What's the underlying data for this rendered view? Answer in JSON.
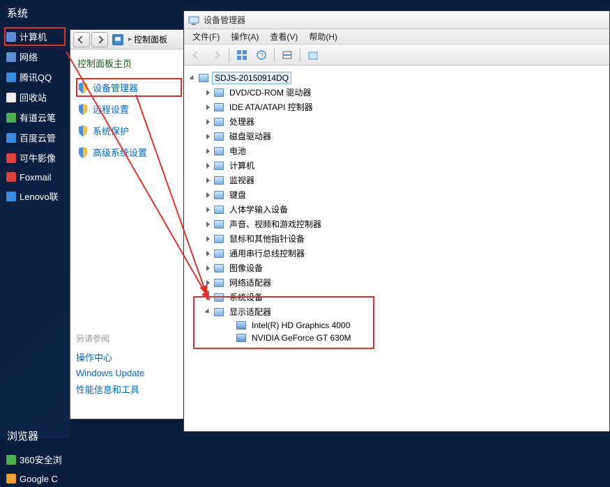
{
  "desktop": {
    "group1_title": "系统",
    "items1": [
      {
        "label": "计算机",
        "icon": "computer-icon",
        "color": "#5a8fd6",
        "highlight": true
      },
      {
        "label": "网络",
        "icon": "network-icon",
        "color": "#5a8fd6"
      },
      {
        "label": "腾讯QQ",
        "icon": "qq-icon",
        "color": "#3a8dde"
      },
      {
        "label": "回收站",
        "icon": "recyclebin-icon",
        "color": "#f0f0f0"
      },
      {
        "label": "有道云笔",
        "icon": "youdao-icon",
        "color": "#4caf50"
      },
      {
        "label": "百度云管",
        "icon": "baidu-icon",
        "color": "#3a8dde"
      },
      {
        "label": "可牛影像",
        "icon": "keniu-icon",
        "color": "#e04040"
      },
      {
        "label": "Foxmail",
        "icon": "foxmail-icon",
        "color": "#e04040"
      },
      {
        "label": "Lenovo联",
        "icon": "lenovo-icon",
        "color": "#3a8dde"
      }
    ],
    "group2_title": "浏览器",
    "items2": [
      {
        "label": "360安全浏",
        "icon": "360-icon",
        "color": "#4caf50"
      },
      {
        "label": "Google C",
        "icon": "chrome-icon",
        "color": "#f0a030"
      }
    ]
  },
  "control_panel": {
    "breadcrumb": {
      "root": "控制面板"
    },
    "home_title": "控制面板主页",
    "links": [
      {
        "label": "设备管理器",
        "highlight": true
      },
      {
        "label": "远程设置"
      },
      {
        "label": "系统保护"
      },
      {
        "label": "高级系统设置"
      }
    ],
    "seealso_title": "另请参阅",
    "seealso": [
      {
        "label": "操作中心"
      },
      {
        "label": "Windows Update"
      },
      {
        "label": "性能信息和工具"
      }
    ]
  },
  "device_manager": {
    "title": "设备管理器",
    "menus": [
      {
        "label": "文件(F)"
      },
      {
        "label": "操作(A)"
      },
      {
        "label": "查看(V)"
      },
      {
        "label": "帮助(H)"
      }
    ],
    "root_label": "SDJS-20150914DQ",
    "categories": [
      {
        "label": "DVD/CD-ROM 驱动器",
        "expanded": false
      },
      {
        "label": "IDE ATA/ATAPI 控制器",
        "expanded": false
      },
      {
        "label": "处理器",
        "expanded": false
      },
      {
        "label": "磁盘驱动器",
        "expanded": false
      },
      {
        "label": "电池",
        "expanded": false
      },
      {
        "label": "计算机",
        "expanded": false
      },
      {
        "label": "监视器",
        "expanded": false
      },
      {
        "label": "键盘",
        "expanded": false
      },
      {
        "label": "人体学输入设备",
        "expanded": false
      },
      {
        "label": "声音、视频和游戏控制器",
        "expanded": false
      },
      {
        "label": "鼠标和其他指针设备",
        "expanded": false
      },
      {
        "label": "通用串行总线控制器",
        "expanded": false
      },
      {
        "label": "图像设备",
        "expanded": false
      },
      {
        "label": "网络适配器",
        "expanded": false
      },
      {
        "label": "系统设备",
        "expanded": false
      },
      {
        "label": "显示适配器",
        "expanded": true,
        "children": [
          {
            "label": "Intel(R) HD Graphics 4000"
          },
          {
            "label": "NVIDIA GeForce GT 630M"
          }
        ]
      }
    ]
  }
}
